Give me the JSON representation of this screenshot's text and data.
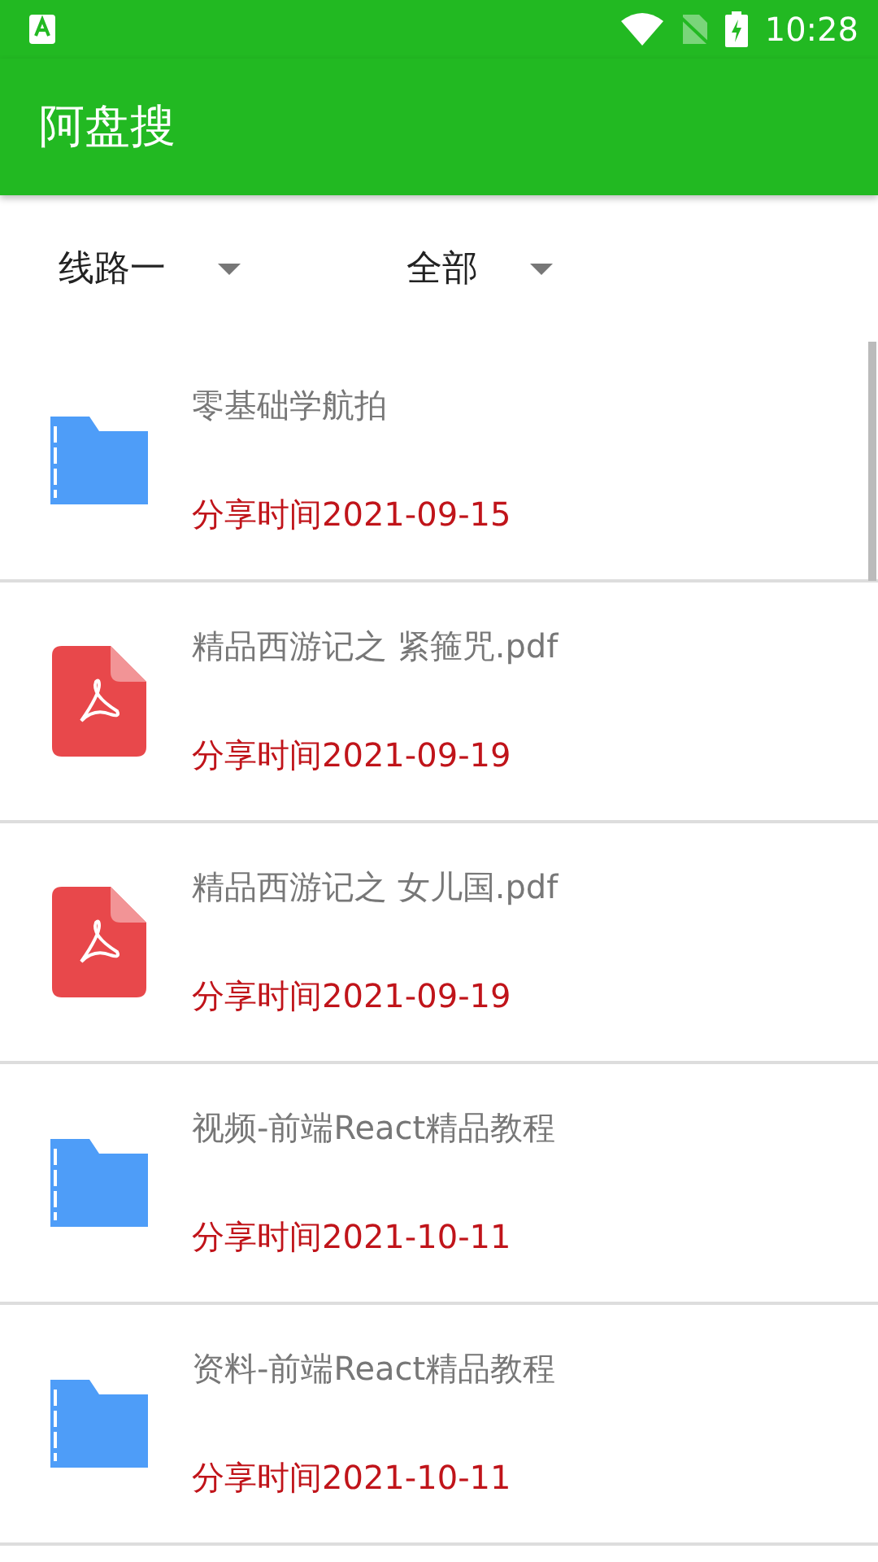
{
  "status_bar": {
    "time": "10:28"
  },
  "app_bar": {
    "title": "阿盘搜"
  },
  "filters": [
    {
      "label": "线路一"
    },
    {
      "label": "全部"
    }
  ],
  "files": [
    {
      "kind": "folder",
      "name": "零基础学航拍",
      "shared": "分享时间2021-09-15"
    },
    {
      "kind": "pdf",
      "name": "精品西游记之 紧箍咒.pdf",
      "shared": "分享时间2021-09-19"
    },
    {
      "kind": "pdf",
      "name": "精品西游记之 女儿国.pdf",
      "shared": "分享时间2021-09-19"
    },
    {
      "kind": "folder",
      "name": "视频-前端React精品教程",
      "shared": "分享时间2021-10-11"
    },
    {
      "kind": "folder",
      "name": "资料-前端React精品教程",
      "shared": "分享时间2021-10-11"
    }
  ]
}
